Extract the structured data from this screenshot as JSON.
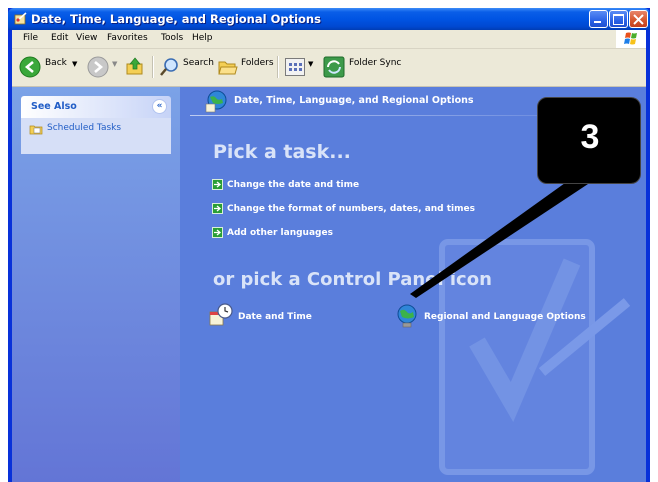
{
  "window": {
    "title": "Date, Time, Language, and Regional Options"
  },
  "menubar": {
    "items": [
      "File",
      "Edit",
      "View",
      "Favorites",
      "Tools",
      "Help"
    ]
  },
  "toolbar": {
    "back_label": "Back",
    "search_label": "Search",
    "folders_label": "Folders",
    "folder_sync_label": "Folder Sync"
  },
  "sidepanel": {
    "see_also_title": "See Also",
    "links": [
      "Scheduled Tasks"
    ]
  },
  "main": {
    "header_title": "Date, Time, Language, and Regional Options",
    "pick_task_heading": "Pick a task...",
    "tasks": [
      "Change the date and time",
      "Change the format of numbers, dates, and times",
      "Add other languages"
    ],
    "or_pick_heading": "or pick a Control Panel icon",
    "icons": [
      "Date and Time",
      "Regional and Language Options"
    ]
  },
  "annotation": {
    "step_number": "3"
  },
  "colors": {
    "content_bg": "#5a7edc",
    "sidepanel_link": "#215dc6",
    "titlebar": "#0054e3",
    "callout": "#000000"
  }
}
